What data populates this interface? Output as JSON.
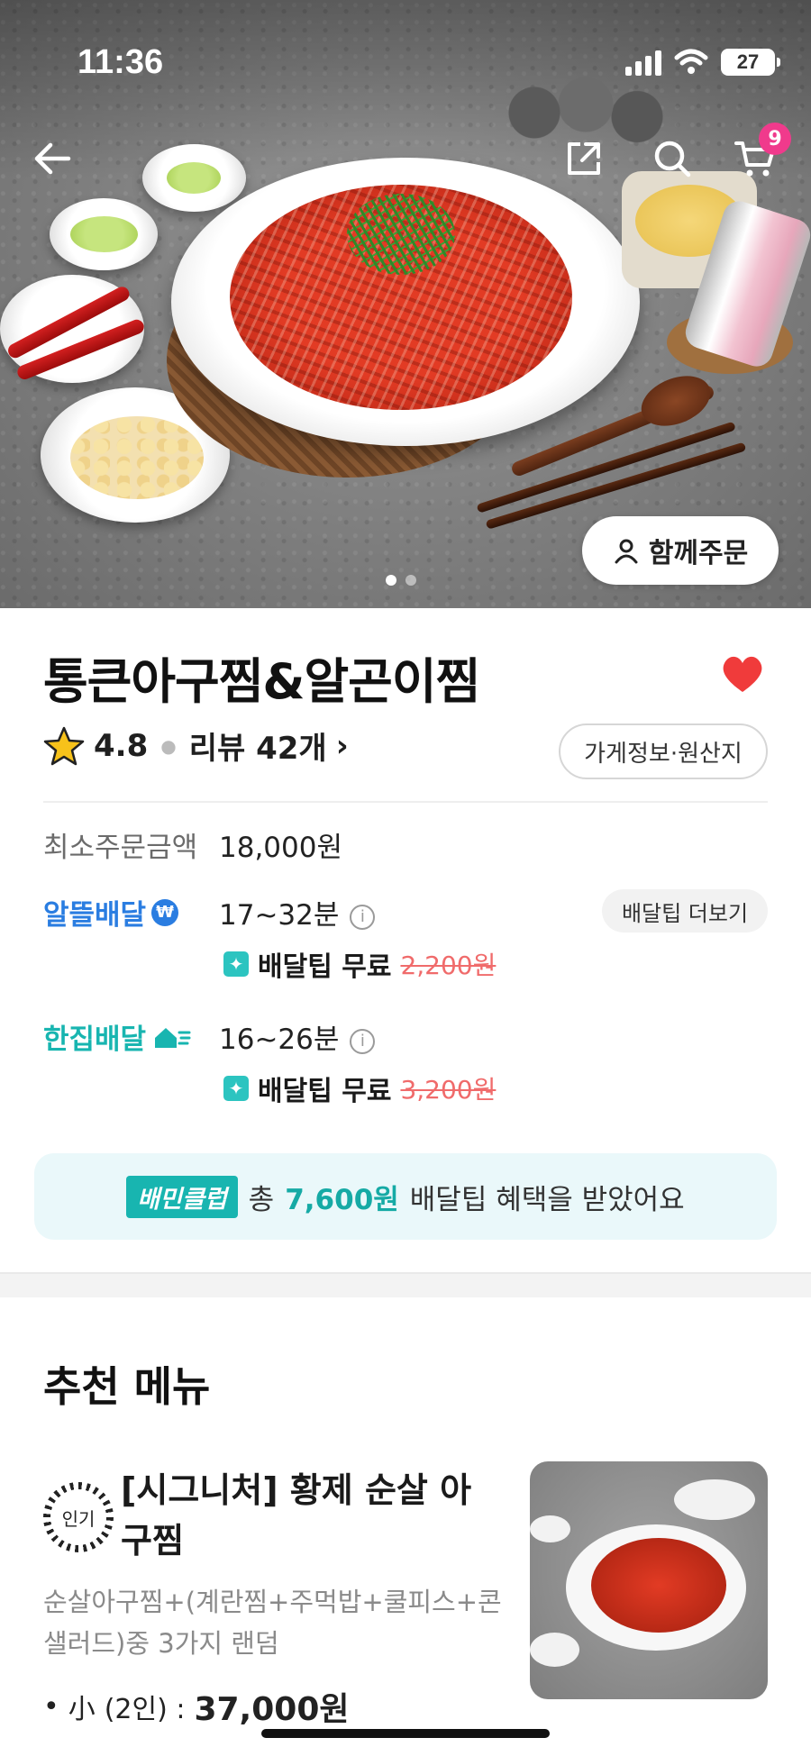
{
  "status_bar": {
    "time": "11:36",
    "battery": "27"
  },
  "hero": {
    "cart_count": "9",
    "together_order_label": "함께주문",
    "page_dots": 2,
    "active_dot": 0
  },
  "store": {
    "name": "통큰아구찜&알곤이찜",
    "rating": "4.8",
    "review_label": "리뷰 42개",
    "review_chevron": "›",
    "info_button": "가게정보·원산지",
    "favorited": true
  },
  "delivery": {
    "min_order_label": "최소주문금액",
    "min_order_value": "18,000원",
    "options": [
      {
        "name": "알뜰배달",
        "time": "17~32분",
        "tip_label": "배달팁 무료",
        "original_tip": "2,200원"
      },
      {
        "name": "한집배달",
        "time": "16~26분",
        "tip_label": "배달팁 무료",
        "original_tip": "3,200원"
      }
    ],
    "more_tips_button": "배달팁 더보기"
  },
  "club_banner": {
    "logo": "배민클럽",
    "prefix": "총",
    "amount": "7,600원",
    "suffix": "배달팁 혜택을 받았어요"
  },
  "recommended": {
    "title": "추천 메뉴",
    "items": [
      {
        "badge": "인기",
        "name": "[시그니처] 황제 순살 아구찜",
        "description": "순살아구찜+(계란찜+주먹밥+쿨피스+콘샐러드)중 3가지 랜덤",
        "size_label": "小",
        "servings": "(2인) :",
        "price": "37,000원"
      }
    ]
  },
  "colors": {
    "brand_blue": "#2a7de1",
    "brand_teal": "#18b5b0",
    "heart_red": "#f03b3b",
    "badge_pink": "#f03a8c",
    "strike_red": "#f06b6b"
  },
  "icons": [
    "back-arrow-icon",
    "share-icon",
    "search-icon",
    "cart-icon",
    "person-icon",
    "heart-icon",
    "star-icon",
    "info-icon",
    "sparkle-icon"
  ]
}
